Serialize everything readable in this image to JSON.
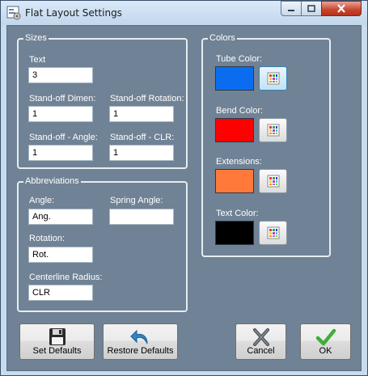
{
  "window": {
    "title": "Flat Layout Settings"
  },
  "sizes": {
    "group_label": "Sizes",
    "text_label": "Text",
    "text_value": "3",
    "standoff_dimen_label": "Stand-off Dimen:",
    "standoff_dimen_value": "1",
    "standoff_rotation_label": "Stand-off Rotation:",
    "standoff_rotation_value": "1",
    "standoff_angle_label": "Stand-off - Angle:",
    "standoff_angle_value": "1",
    "standoff_clr_label": "Stand-off - CLR:",
    "standoff_clr_value": "1"
  },
  "abbreviations": {
    "group_label": "Abbreviations",
    "angle_label": "Angle:",
    "angle_value": "Ang.",
    "spring_angle_label": "Spring Angle:",
    "spring_angle_value": "",
    "rotation_label": "Rotation:",
    "rotation_value": "Rot.",
    "centerline_radius_label": "Centerline Radius:",
    "centerline_radius_value": "CLR"
  },
  "colors": {
    "group_label": "Colors",
    "tube_label": "Tube Color:",
    "tube_color": "#0a6df0",
    "bend_label": "Bend Color:",
    "bend_color": "#ff0000",
    "extensions_label": "Extensions:",
    "extensions_color": "#ff7a3a",
    "text_label": "Text Color:",
    "text_color": "#000000"
  },
  "buttons": {
    "set_defaults": "Set Defaults",
    "restore_defaults": "Restore Defaults",
    "cancel": "Cancel",
    "ok": "OK"
  },
  "icons": {
    "app": "settings-window-icon",
    "minimize": "minimize-icon",
    "maximize": "maximize-icon",
    "close": "close-icon",
    "color_picker": "color-palette-icon",
    "save": "floppy-disk-icon",
    "restore": "undo-arrow-icon",
    "cancel": "x-icon",
    "ok": "checkmark-icon"
  }
}
